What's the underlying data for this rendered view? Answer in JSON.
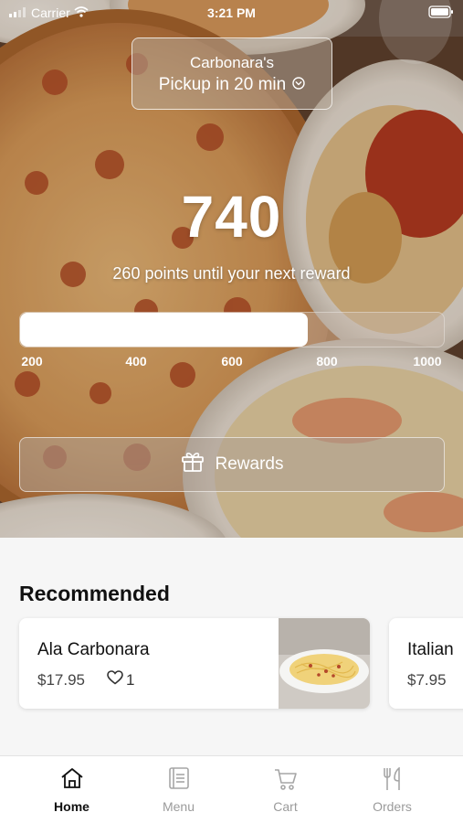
{
  "status_bar": {
    "carrier": "Carrier",
    "time": "3:21 PM"
  },
  "store": {
    "name": "Carbonara's",
    "pickup": "Pickup in 20 min"
  },
  "rewards": {
    "points": "740",
    "points_value": 740,
    "subtitle": "260 points until your next reward",
    "scale_min": 200,
    "scale_max": 1000,
    "ticks": [
      "200",
      "400",
      "600",
      "800",
      "1000"
    ],
    "button_label": "Rewards"
  },
  "recommended": {
    "title": "Recommended",
    "items": [
      {
        "name": "Ala Carbonara",
        "price": "$17.95",
        "likes": "1"
      },
      {
        "name": "Italian",
        "price": "$7.95"
      }
    ]
  },
  "tabs": [
    {
      "label": "Home",
      "icon": "home-icon"
    },
    {
      "label": "Menu",
      "icon": "menu-icon"
    },
    {
      "label": "Cart",
      "icon": "cart-icon"
    },
    {
      "label": "Orders",
      "icon": "orders-icon"
    }
  ],
  "colors": {
    "active_tab": "#111111",
    "inactive_tab": "#9b9b9b",
    "progress_fill": "#ffffff"
  }
}
